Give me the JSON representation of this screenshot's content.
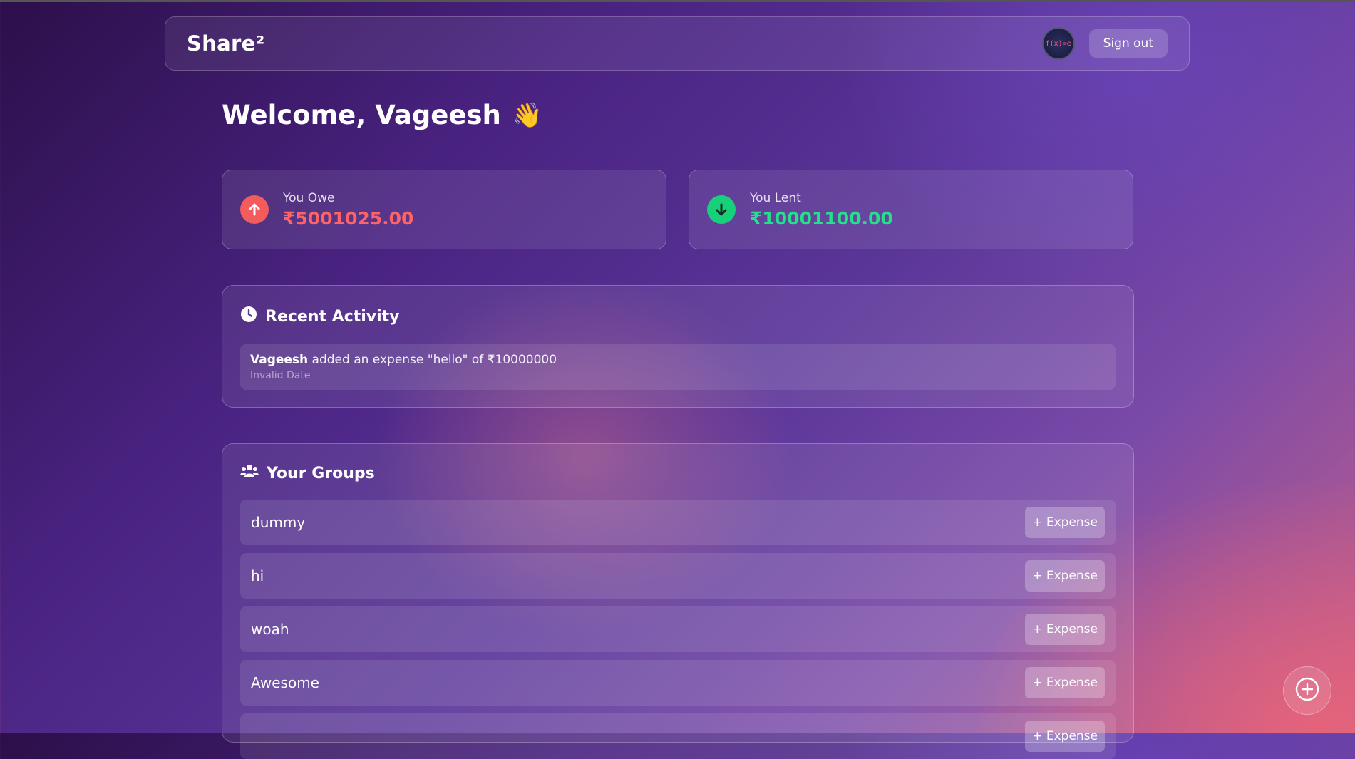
{
  "app": {
    "brand": "Share²",
    "avatar_text": "f(x)=e",
    "signout_label": "Sign out"
  },
  "welcome": {
    "text": "Welcome, Vageesh",
    "emoji": "👋"
  },
  "stats": {
    "owe": {
      "label": "You Owe",
      "value": "₹5001025.00",
      "icon": "arrow-up-circle-icon",
      "color": "#f25c5c"
    },
    "lent": {
      "label": "You Lent",
      "value": "₹10001100.00",
      "icon": "arrow-down-circle-icon",
      "color": "#17d17a"
    }
  },
  "activity": {
    "title": "Recent Activity",
    "icon": "clock-icon",
    "items": [
      {
        "user": "Vageesh",
        "text": " added an expense \"hello\" of ₹10000000",
        "date": "Invalid Date"
      }
    ]
  },
  "groups": {
    "title": "Your Groups",
    "icon": "users-icon",
    "button_label": "+ Expense",
    "items": [
      {
        "name": "dummy"
      },
      {
        "name": "hi"
      },
      {
        "name": "woah"
      },
      {
        "name": "Awesome"
      },
      {
        "name": ""
      }
    ]
  },
  "fab": {
    "icon": "plus-circle-icon"
  }
}
